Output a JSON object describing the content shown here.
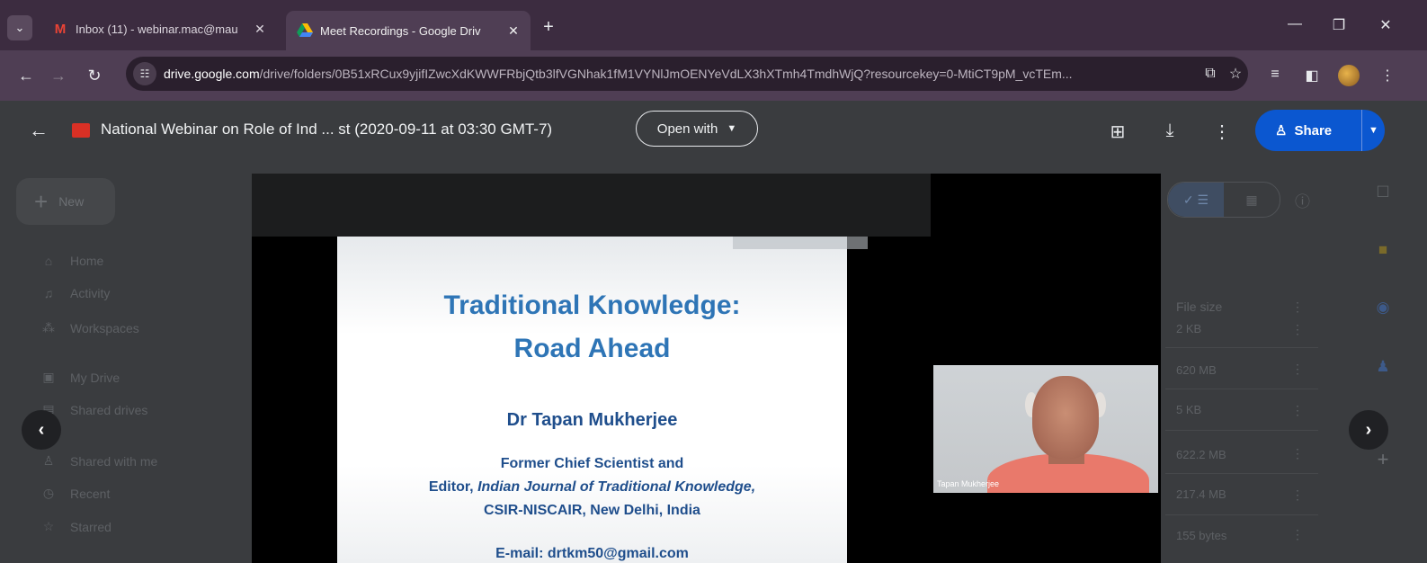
{
  "browser": {
    "tabs": [
      {
        "title": "Inbox (11) - webinar.mac@mau",
        "favicon": "gmail-icon",
        "close": "✕"
      },
      {
        "title": "Meet Recordings - Google Driv",
        "favicon": "google-drive-icon",
        "close": "✕"
      }
    ],
    "new_tab": "+",
    "address": {
      "host": "drive.google.com",
      "path": "/drive/folders/0B51xRCux9yjifIZwcXdKWWFRbjQtb3lfVGNhak1fM1VYNlJmOENYeVdLX3hXTmh4TmdhWjQ?resourcekey=0-MtiCT9pM_vcTEm..."
    }
  },
  "viewer": {
    "file_title": "National Webinar on Role of Ind ... st (2020-09-11 at 03:30 GMT-7)",
    "open_with": "Open with",
    "share": "Share"
  },
  "drive_bg": {
    "new_label": "New",
    "nav": [
      "Home",
      "Activity",
      "Workspaces",
      "My Drive",
      "Shared drives",
      "Shared with me",
      "Recent",
      "Starred"
    ],
    "file_size_header": "File size",
    "sizes": [
      "2 KB",
      "620 MB",
      "5 KB",
      "622.2 MB",
      "217.4 MB",
      "155 bytes"
    ]
  },
  "video": {
    "slide": {
      "title_line1": "Traditional Knowledge:",
      "title_line2": "Road Ahead",
      "author": "Dr Tapan Mukherjee",
      "role_line1": "Former Chief Scientist and",
      "role_line2_prefix": "Editor, ",
      "role_line2_journal": "Indian Journal of Traditional Knowledge,",
      "role_line3": "CSIR-NISCAIR, New Delhi, India",
      "email": "E-mail: drtkm50@gmail.com"
    },
    "participant_name": "Tapan Mukherjee"
  },
  "colors": {
    "slide_title": "#2e75b6",
    "slide_text": "#1f4e8c",
    "share_button": "#0b57d0",
    "tab_strip": "#3c2c40"
  }
}
